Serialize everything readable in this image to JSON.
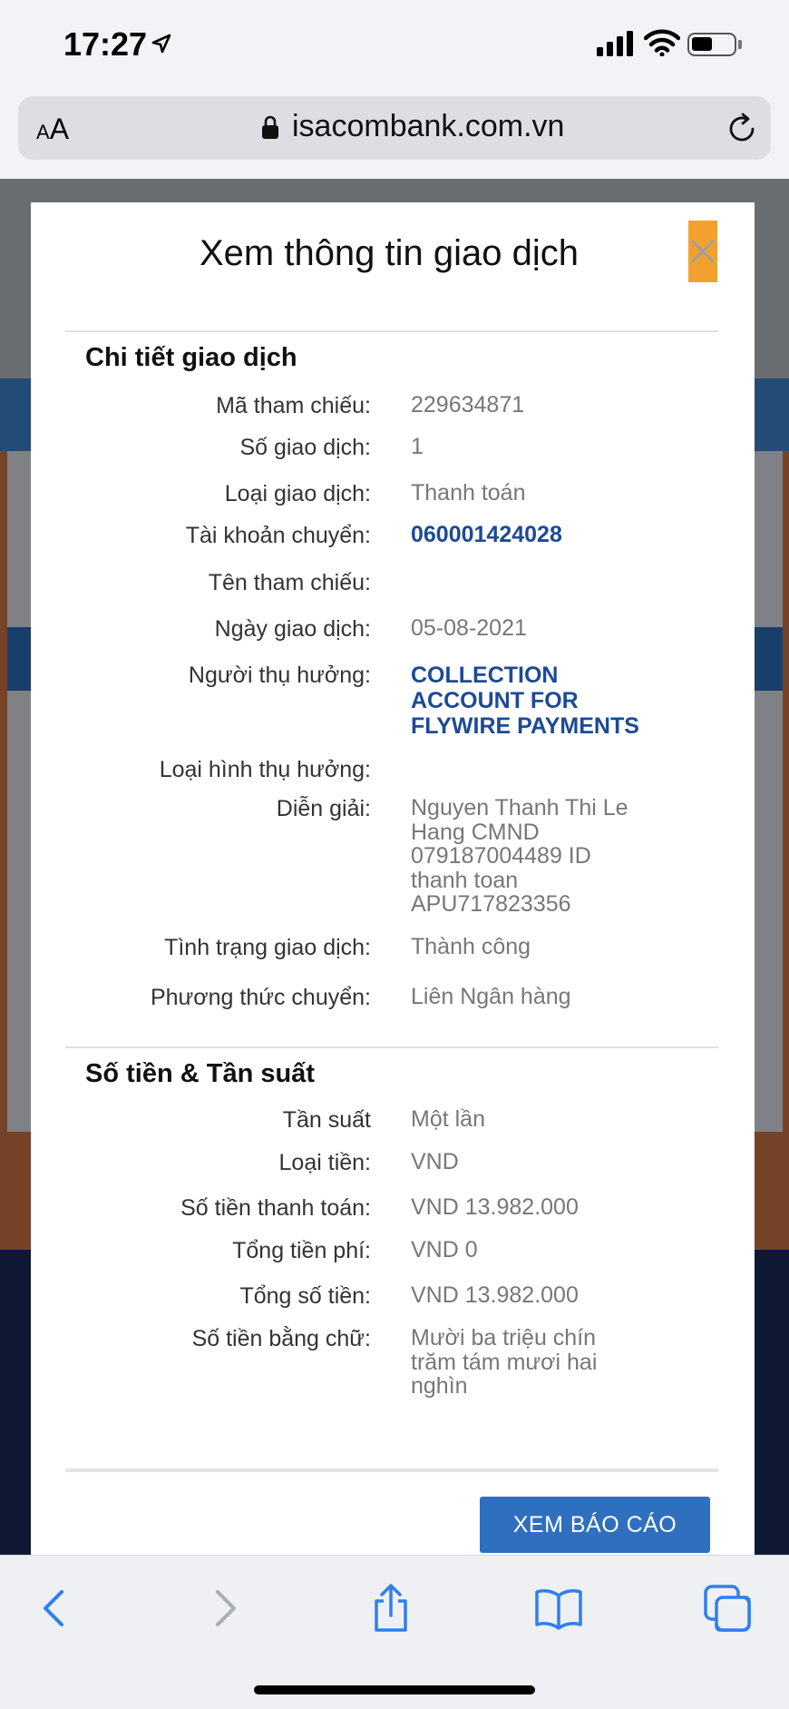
{
  "status_bar": {
    "time": "17:27"
  },
  "browser": {
    "aa_small": "A",
    "aa_large": "A",
    "url": "isacombank.com.vn"
  },
  "modal": {
    "title": "Xem thông tin giao dịch",
    "sections": {
      "details_title": "Chi tiết giao dịch",
      "amount_title": "Số tiền & Tần suất"
    },
    "rows": {
      "ref_code": {
        "label": "Mã tham chiếu:",
        "value": "229634871"
      },
      "tx_number": {
        "label": "Số giao dịch:",
        "value": "1"
      },
      "tx_type": {
        "label": "Loại giao dịch:",
        "value": "Thanh toán"
      },
      "from_account": {
        "label": "Tài khoản chuyển:",
        "value": "060001424028"
      },
      "ref_name": {
        "label": "Tên tham chiếu:",
        "value": ""
      },
      "tx_date": {
        "label": "Ngày giao dịch:",
        "value": "05-08-2021"
      },
      "beneficiary": {
        "label": "Người thụ hưởng:",
        "value": "COLLECTION ACCOUNT FOR FLYWIRE PAYMENTS"
      },
      "beneficiary_type": {
        "label": "Loại hình thụ hưởng:",
        "value": ""
      },
      "description": {
        "label": "Diễn giải:",
        "value": "Nguyen Thanh Thi Le Hang CMND 079187004489 ID thanh toan APU717823356"
      },
      "tx_status": {
        "label": "Tình trạng giao dịch:",
        "value": "Thành công"
      },
      "transfer_method": {
        "label": "Phương thức chuyển:",
        "value": "Liên Ngân hàng"
      },
      "frequency": {
        "label": "Tần suất",
        "value": "Một lần"
      },
      "currency": {
        "label": "Loại tiền:",
        "value": "VND"
      },
      "payment_amount": {
        "label": "Số tiền thanh toán:",
        "value": "VND 13.982.000"
      },
      "total_fee": {
        "label": "Tổng tiền phí:",
        "value": "VND 0"
      },
      "total_amount": {
        "label": "Tổng số tiền:",
        "value": "VND 13.982.000"
      },
      "amount_in_words": {
        "label": "Số tiền bằng chữ:",
        "value": "Mười ba triệu chín trăm tám mươi hai nghìn"
      }
    },
    "report_button": "XEM BÁO CÁO"
  },
  "icons": {
    "close": "close-icon",
    "back": "back-arrow-icon",
    "forward": "forward-arrow-icon",
    "share": "share-icon",
    "bookmarks": "bookmarks-icon",
    "tabs": "tabs-icon"
  },
  "colors": {
    "accent_orange": "#f3a12e",
    "link_blue": "#1c4a96",
    "button_blue": "#2f6fbf",
    "ios_blue": "#2f7ff0"
  }
}
